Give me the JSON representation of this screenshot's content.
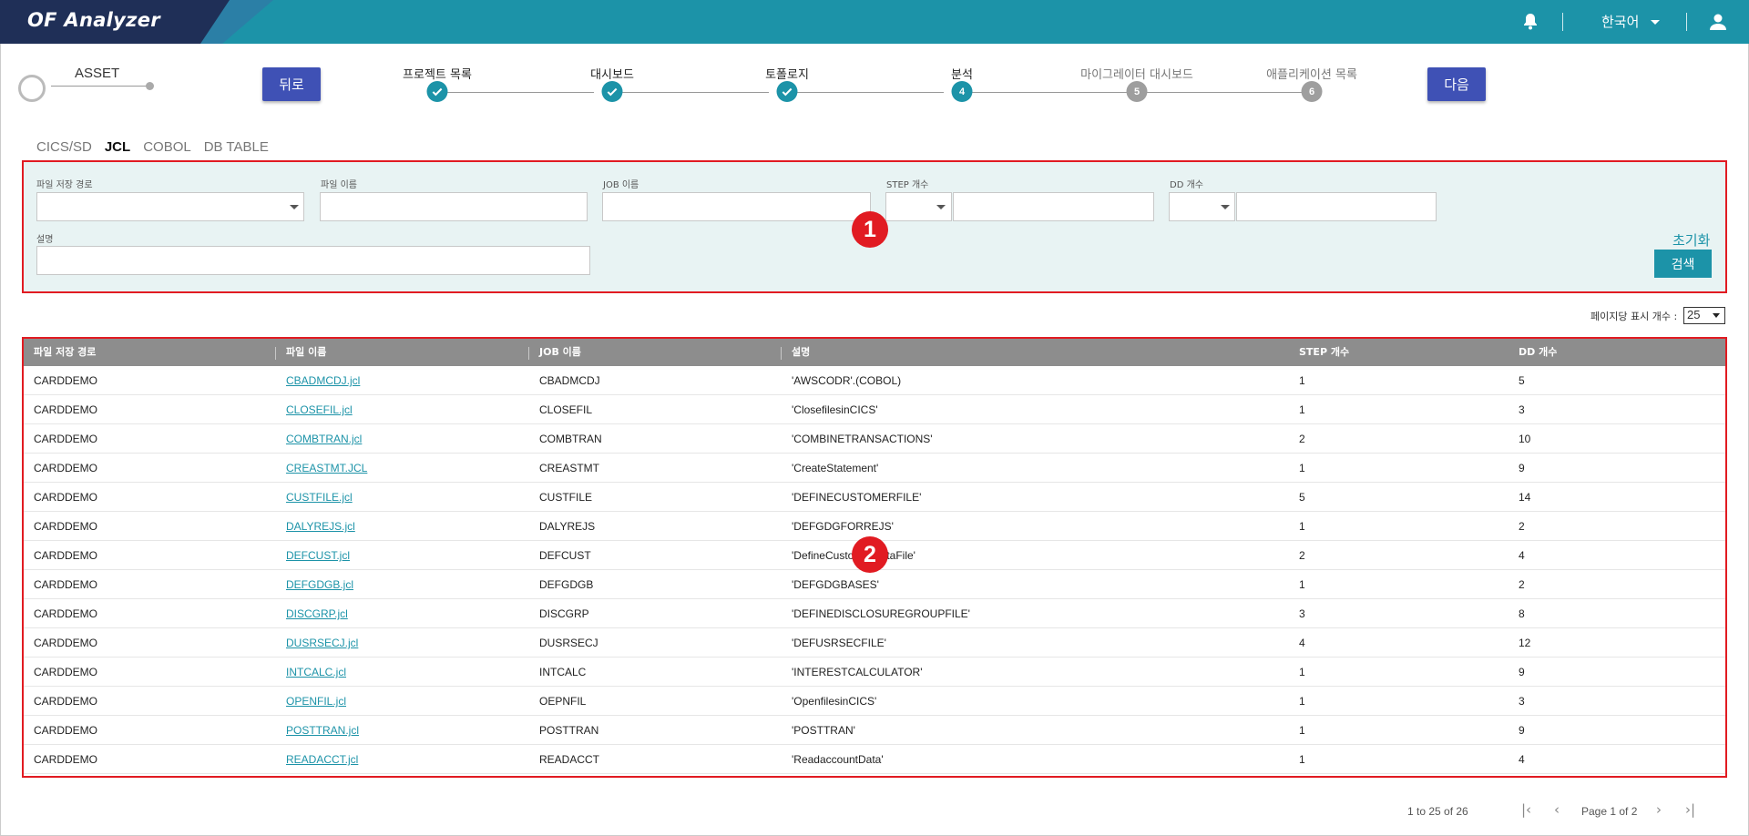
{
  "app": {
    "title": "OF Analyzer",
    "language": "한국어"
  },
  "icons": {
    "bell": "bell-icon",
    "user": "user-icon"
  },
  "asset": {
    "label": "ASSET"
  },
  "nav": {
    "back_label": "뒤로",
    "next_label": "다음"
  },
  "steps": [
    {
      "label": "프로젝트 목록",
      "state": "done",
      "num": ""
    },
    {
      "label": "대시보드",
      "state": "done",
      "num": ""
    },
    {
      "label": "토폴로지",
      "state": "done",
      "num": ""
    },
    {
      "label": "분석",
      "state": "current",
      "num": "4"
    },
    {
      "label": "마이그레이터 대시보드",
      "state": "todo",
      "num": "5"
    },
    {
      "label": "애플리케이션 목록",
      "state": "todo",
      "num": "6"
    }
  ],
  "tabs": [
    {
      "label": "CICS/SD",
      "active": false
    },
    {
      "label": "JCL",
      "active": true
    },
    {
      "label": "COBOL",
      "active": false
    },
    {
      "label": "DB TABLE",
      "active": false
    }
  ],
  "filter": {
    "path_label": "파일 저장 경로",
    "path_value": "",
    "filename_label": "파일 이름",
    "filename_value": "",
    "job_label": "JOB 이름",
    "job_value": "",
    "step_label": "STEP 개수",
    "step_value": "",
    "dd_label": "DD 개수",
    "dd_value": "",
    "desc_label": "설명",
    "desc_value": "",
    "reset_label": "초기화",
    "search_label": "검색"
  },
  "markers": {
    "m1": "1",
    "m2": "2"
  },
  "perpage": {
    "label": "페이지당 표시 개수 :",
    "value": "25"
  },
  "table": {
    "headers": [
      "파일 저장 경로",
      "파일 이름",
      "JOB 이름",
      "설명",
      "STEP 개수",
      "DD 개수"
    ],
    "rows": [
      [
        "CARDDEMO",
        "CBADMCDJ.jcl",
        "CBADMCDJ",
        "'AWSCODR'.(COBOL)",
        "1",
        "5"
      ],
      [
        "CARDDEMO",
        "CLOSEFIL.jcl",
        "CLOSEFIL",
        "'ClosefilesinCICS'",
        "1",
        "3"
      ],
      [
        "CARDDEMO",
        "COMBTRAN.jcl",
        "COMBTRAN",
        "'COMBINETRANSACTIONS'",
        "2",
        "10"
      ],
      [
        "CARDDEMO",
        "CREASTMT.JCL",
        "CREASTMT",
        "'CreateStatement'",
        "1",
        "9"
      ],
      [
        "CARDDEMO",
        "CUSTFILE.jcl",
        "CUSTFILE",
        "'DEFINECUSTOMERFILE'",
        "5",
        "14"
      ],
      [
        "CARDDEMO",
        "DALYREJS.jcl",
        "DALYREJS",
        "'DEFGDGFORREJS'",
        "1",
        "2"
      ],
      [
        "CARDDEMO",
        "DEFCUST.jcl",
        "DEFCUST",
        "'DefineCustomerDataFile'",
        "2",
        "4"
      ],
      [
        "CARDDEMO",
        "DEFGDGB.jcl",
        "DEFGDGB",
        "'DEFGDGBASES'",
        "1",
        "2"
      ],
      [
        "CARDDEMO",
        "DISCGRP.jcl",
        "DISCGRP",
        "'DEFINEDISCLOSUREGROUPFILE'",
        "3",
        "8"
      ],
      [
        "CARDDEMO",
        "DUSRSECJ.jcl",
        "DUSRSECJ",
        "'DEFUSRSECFILE'",
        "4",
        "12"
      ],
      [
        "CARDDEMO",
        "INTCALC.jcl",
        "INTCALC",
        "'INTERESTCALCULATOR'",
        "1",
        "9"
      ],
      [
        "CARDDEMO",
        "OPENFIL.jcl",
        "OEPNFIL",
        "'OpenfilesinCICS'",
        "1",
        "3"
      ],
      [
        "CARDDEMO",
        "POSTTRAN.jcl",
        "POSTTRAN",
        "'POSTTRAN'",
        "1",
        "9"
      ],
      [
        "CARDDEMO",
        "READACCT.jcl",
        "READACCT",
        "'ReadaccountData'",
        "1",
        "4"
      ]
    ]
  },
  "pagination": {
    "range": "1 to 25 of 26",
    "page": "Page 1 of 2",
    "first": "|‹",
    "prev": "‹",
    "next": "›",
    "last": "›|"
  },
  "colors": {
    "header": "#1c93a8",
    "logo_bg": "#1f2f57",
    "primary_button": "#3f51b5",
    "highlight": "#e11b22",
    "step_todo": "#9e9e9e"
  }
}
